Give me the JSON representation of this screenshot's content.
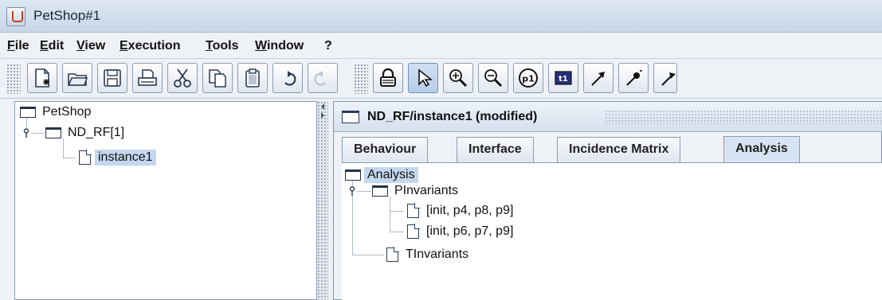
{
  "window": {
    "title": "PetShop#1"
  },
  "menu": [
    "File",
    "Edit",
    "View",
    "Execution",
    "Tools",
    "Window",
    "?"
  ],
  "toolbar": {
    "file_group": [
      "new-file-icon",
      "open-folder-icon",
      "save-icon",
      "print-icon",
      "cut-icon",
      "copy-icon",
      "paste-icon",
      "undo-icon",
      "redo-icon"
    ],
    "edit_group": [
      "lock-icon",
      "pointer-icon",
      "zoom-in-icon",
      "zoom-out-icon",
      "place-icon",
      "transition-icon",
      "arc-icon",
      "inhibitor-arc-icon",
      "test-arc-icon"
    ],
    "place_label": "p1",
    "transition_label": "t1"
  },
  "tree": {
    "root": "PetShop",
    "child": "ND_RF[1]",
    "leaf": "instance1"
  },
  "frame": {
    "title": "ND_RF/instance1 (modified)",
    "tabs": [
      "Behaviour",
      "Interface",
      "Incidence Matrix",
      "Analysis"
    ],
    "active_tab": "Analysis"
  },
  "analysis": {
    "root": "Analysis",
    "pinvariants": "PInvariants",
    "pinv_items": [
      "[init, p4, p8, p9]",
      "[init, p6, p7, p9]"
    ],
    "tinvariants": "TInvariants"
  },
  "colors": {
    "selection": "#c3d7ee",
    "accent": "#7f93ad"
  }
}
